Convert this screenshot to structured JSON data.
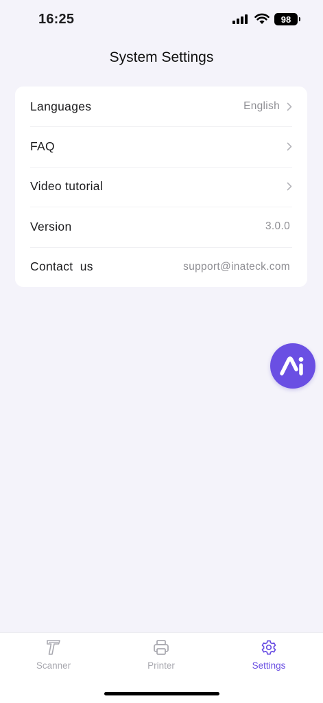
{
  "status_bar": {
    "time": "16:25",
    "battery": "98",
    "icons": [
      "cellular-signal-icon",
      "wifi-icon",
      "battery-icon"
    ]
  },
  "header": {
    "title": "System Settings"
  },
  "settings": {
    "rows": [
      {
        "label": "Languages",
        "value": "English",
        "chevron": true
      },
      {
        "label": "FAQ",
        "value": "",
        "chevron": true
      },
      {
        "label": "Video tutorial",
        "value": "",
        "chevron": true
      },
      {
        "label": "Version",
        "value": "3.0.0",
        "chevron": false
      },
      {
        "label": "Contact  us",
        "value": "support@inateck.com",
        "chevron": false
      }
    ]
  },
  "fab": {
    "icon": "ai-assistant-icon",
    "color": "#6a4fe3"
  },
  "tab_bar": {
    "active": "Settings",
    "accent_color": "#6a4fe3",
    "inactive_color": "#a9a9b0",
    "tabs": [
      {
        "label": "Scanner",
        "icon": "scanner-icon"
      },
      {
        "label": "Printer",
        "icon": "printer-icon"
      },
      {
        "label": "Settings",
        "icon": "gear-icon"
      }
    ]
  }
}
